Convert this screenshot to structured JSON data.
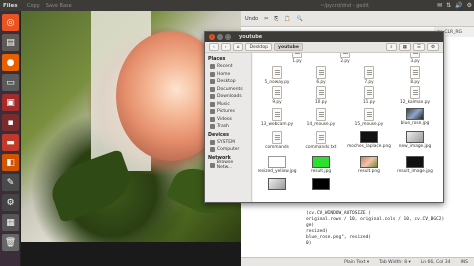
{
  "top_panel": {
    "title": "Files",
    "tray": [
      "✉",
      "⇅",
      "🔊",
      "⚙"
    ]
  },
  "viewer": {
    "title_items": [
      "Copy",
      "Save Base"
    ]
  },
  "gedit": {
    "title": "~/pycrd/dnd - gedit",
    "toolbar": [
      "Undo",
      "✂",
      "⎘",
      "📋",
      "🔍"
    ],
    "tab": "cv_CLR_RG",
    "code": [
      "(cv.CV_WINDOW_AUTOSIZE )",
      "original.rows / 10, original.cols / 10, cv.CV_BGC2)",
      "ge)",
      "resized)",
      "",
      "blue_rose.png\", resized)",
      "0)"
    ],
    "status": [
      "Plain Text ▾",
      "Tab Width: 8 ▾",
      "Ln 66, Col 34",
      "INS"
    ]
  },
  "fm": {
    "title": "youtube",
    "path": [
      "Desktop",
      "youtube"
    ],
    "sidebar": {
      "places_heading": "Places",
      "places": [
        {
          "label": "Recent",
          "icon": "clock-icon"
        },
        {
          "label": "Home",
          "icon": "home-icon"
        },
        {
          "label": "Desktop",
          "icon": "desktop-icon"
        },
        {
          "label": "Documents",
          "icon": "folder-icon"
        },
        {
          "label": "Downloads",
          "icon": "download-icon"
        },
        {
          "label": "Music",
          "icon": "music-icon"
        },
        {
          "label": "Pictures",
          "icon": "picture-icon"
        },
        {
          "label": "Videos",
          "icon": "video-icon"
        },
        {
          "label": "Trash",
          "icon": "trash-icon"
        }
      ],
      "devices_heading": "Devices",
      "devices": [
        {
          "label": "SYSTEM",
          "icon": "drive-icon"
        },
        {
          "label": "Computer",
          "icon": "computer-icon"
        }
      ],
      "network_heading": "Network",
      "network": [
        {
          "label": "Browse Netw...",
          "icon": "network-icon"
        }
      ]
    },
    "files_row0": [
      "1.py",
      "2.py",
      "3.py"
    ],
    "files_row1": [
      "5_noway.py",
      "6.py",
      "7.py",
      "8.py"
    ],
    "files_row2": [
      "9.py",
      "10.py",
      "11.py",
      "12_kalman.py"
    ],
    "files_row3": [
      "13_webcam.py",
      "14_mouse.py",
      "15_mouse.py",
      "blue_rose.jpg"
    ],
    "files_row4": [
      "commands",
      "commands.txt",
      "moches_laplace.png",
      "new_image.jpg"
    ],
    "files_row5": [
      "resized_yellow.jpg",
      "result.jpg",
      "result.png",
      "result_image.jpg"
    ]
  }
}
